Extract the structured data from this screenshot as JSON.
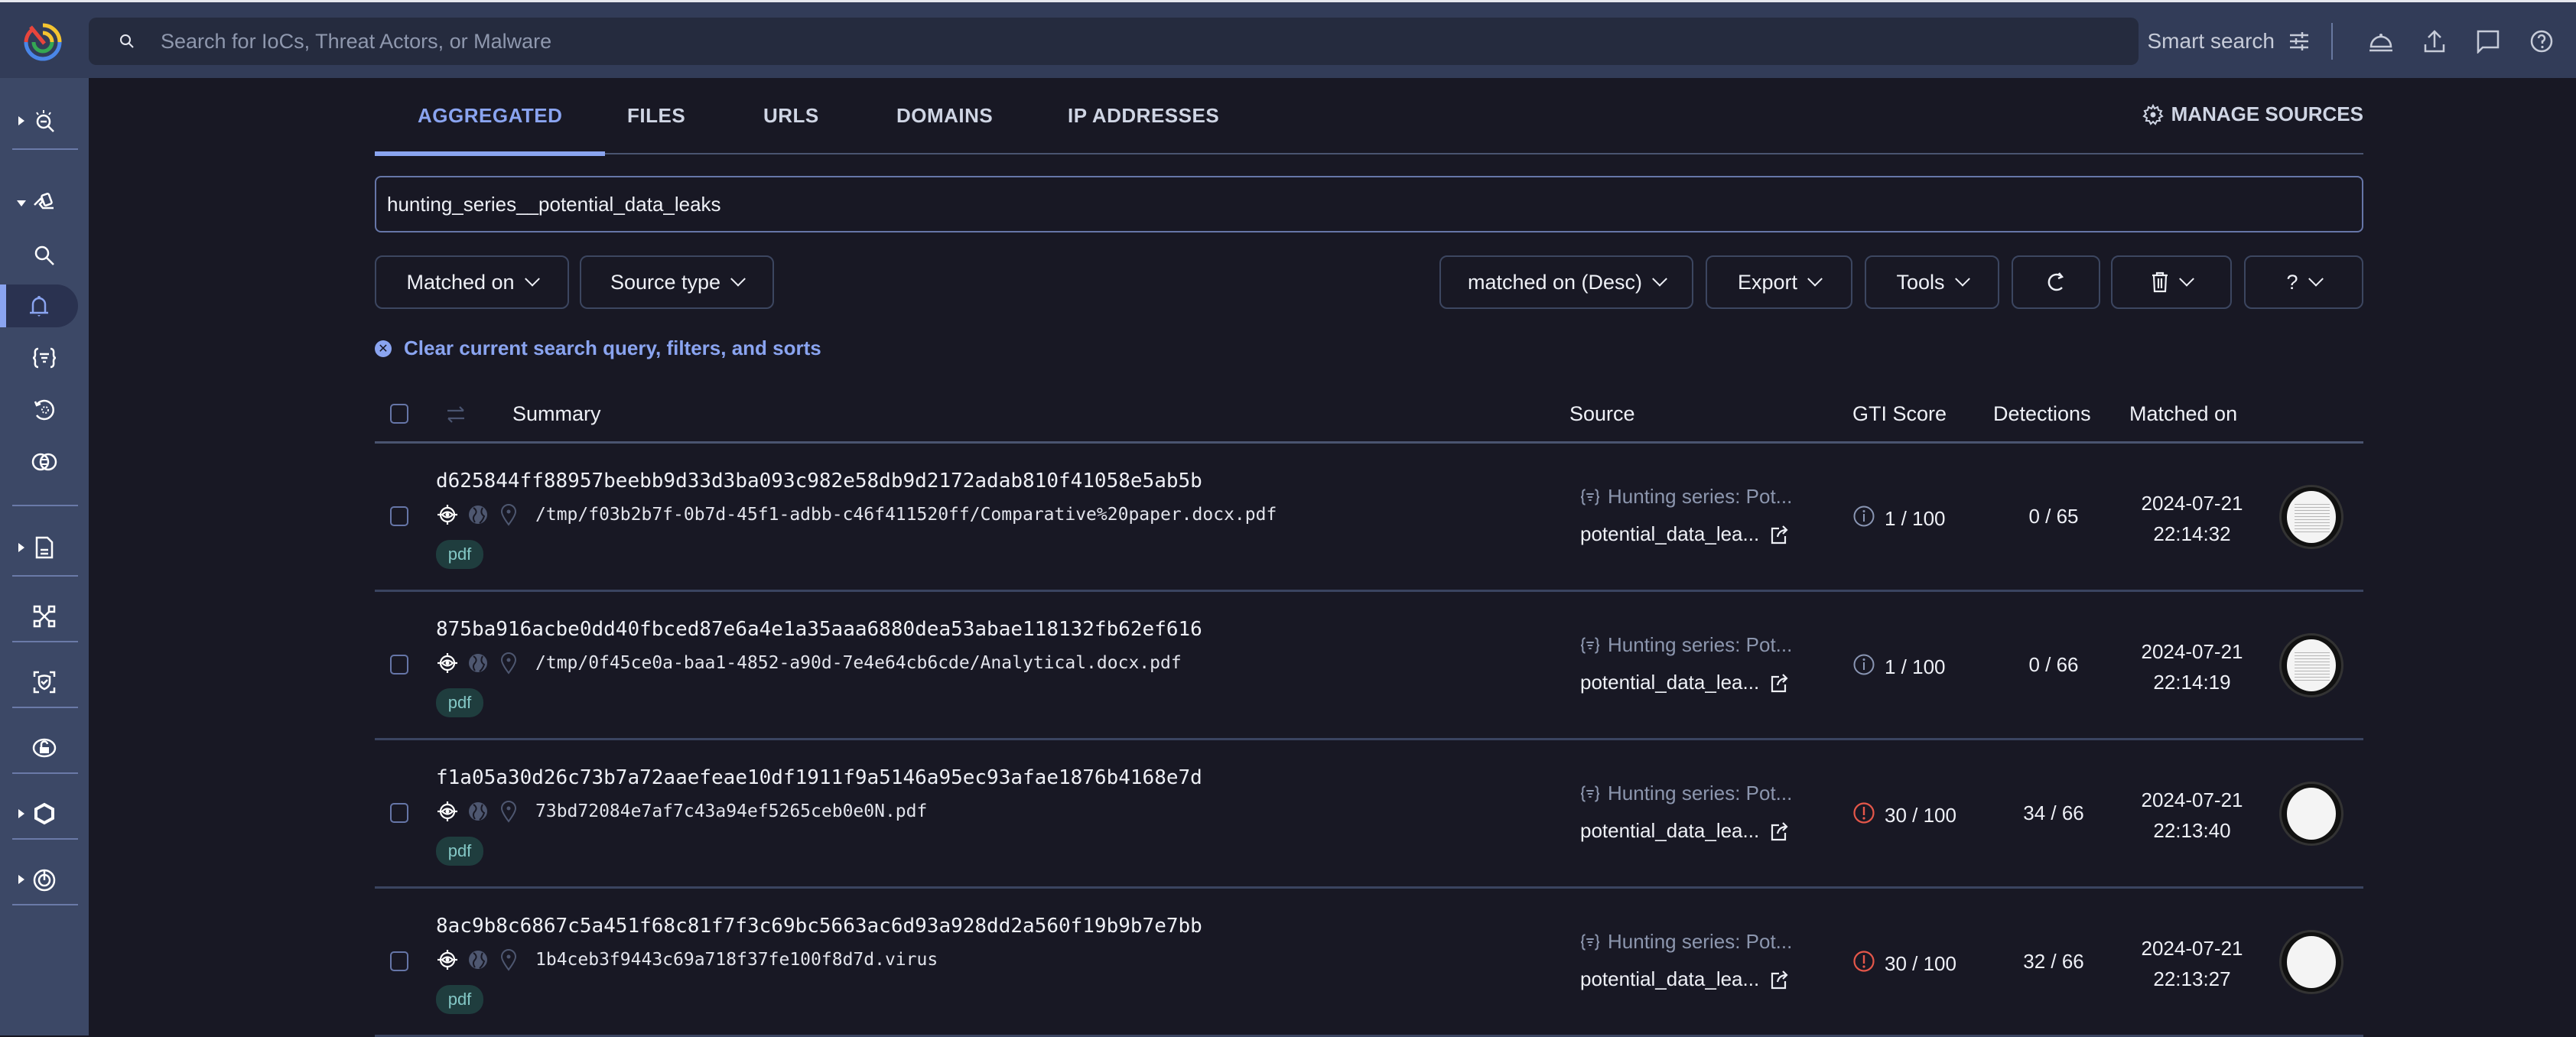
{
  "topbar": {
    "search_placeholder": "Search for IoCs, Threat Actors, or Malware",
    "smart_search_label": "Smart search",
    "icons": [
      "notifications-bell-icon",
      "upload-icon",
      "feedback-chat-icon",
      "help-icon"
    ]
  },
  "sidebar": {
    "items": [
      {
        "icon": "threat-landscape-icon",
        "expandable": true,
        "expanded": false
      },
      {
        "icon": "hunting-icon",
        "expandable": true,
        "expanded": true
      },
      {
        "icon": "search-icon"
      },
      {
        "icon": "bell-icon",
        "active": true
      },
      {
        "icon": "yara-rules-icon"
      },
      {
        "icon": "retrohunt-icon"
      },
      {
        "icon": "diff-icon"
      },
      {
        "icon": "reports-icon",
        "expandable": true,
        "expanded": false
      },
      {
        "icon": "graph-icon"
      },
      {
        "icon": "shield-check-icon"
      },
      {
        "icon": "unlock-icon"
      },
      {
        "icon": "hexagon-icon",
        "expandable": true,
        "expanded": false
      },
      {
        "icon": "asm-icon",
        "expandable": true,
        "expanded": false
      }
    ]
  },
  "tabs": [
    {
      "label": "AGGREGATED",
      "active": true
    },
    {
      "label": "FILES",
      "active": false
    },
    {
      "label": "URLS",
      "active": false
    },
    {
      "label": "DOMAINS",
      "active": false
    },
    {
      "label": "IP ADDRESSES",
      "active": false
    }
  ],
  "manage_sources_label": "MANAGE SOURCES",
  "query_value": "hunting_series__potential_data_leaks",
  "filters": {
    "matched_on": "Matched on",
    "source_type": "Source type",
    "sort": "matched on (Desc)",
    "export": "Export",
    "tools": "Tools",
    "help": "?"
  },
  "clear_label": "Clear current search query, filters, and sorts",
  "table": {
    "headers": {
      "summary": "Summary",
      "source": "Source",
      "gti_score": "GTI Score",
      "detections": "Detections",
      "matched_on": "Matched on"
    },
    "rows": [
      {
        "hash": "d625844ff88957beebb9d33d3ba093c982e58db9d2172adab810f41058e5ab5b",
        "path": "/tmp/f03b2b7f-0b7d-45f1-adbb-c46f411520ff/Comparative%20paper.docx.pdf",
        "tag": "pdf",
        "source_title": "Hunting series: Pot...",
        "source_name": "potential_data_lea...",
        "gti_score": "1 / 100",
        "gti_level": "info",
        "detections": "0 / 65",
        "date": "2024-07-21",
        "time": "22:14:32",
        "thumb": "text"
      },
      {
        "hash": "875ba916acbe0dd40fbced87e6a4e1a35aaa6880dea53abae118132fb62ef616",
        "path": "/tmp/0f45ce0a-baa1-4852-a90d-7e4e64cb6cde/Analytical.docx.pdf",
        "tag": "pdf",
        "source_title": "Hunting series: Pot...",
        "source_name": "potential_data_lea...",
        "gti_score": "1 / 100",
        "gti_level": "info",
        "detections": "0 / 66",
        "date": "2024-07-21",
        "time": "22:14:19",
        "thumb": "text"
      },
      {
        "hash": "f1a05a30d26c73b7a72aaefeae10df1911f9a5146a95ec93afae1876b4168e7d",
        "path": "73bd72084e7af7c43a94ef5265ceb0e0N.pdf",
        "tag": "pdf",
        "source_title": "Hunting series: Pot...",
        "source_name": "potential_data_lea...",
        "gti_score": "30 / 100",
        "gti_level": "warning",
        "detections": "34 / 66",
        "date": "2024-07-21",
        "time": "22:13:40",
        "thumb": "blank"
      },
      {
        "hash": "8ac9b8c6867c5a451f68c81f7f3c69bc5663ac6d93a928dd2a560f19b9b7e7bb",
        "path": "1b4ceb3f9443c69a718f37fe100f8d7d.virus",
        "tag": "pdf",
        "source_title": "Hunting series: Pot...",
        "source_name": "potential_data_lea...",
        "gti_score": "30 / 100",
        "gti_level": "warning",
        "detections": "32 / 66",
        "date": "2024-07-21",
        "time": "22:13:27",
        "thumb": "blank"
      }
    ]
  },
  "colors": {
    "accent": "#8aa4f0",
    "warning": "#e5574a",
    "info": "#8a96b4",
    "tag_bg": "#1f3d3e",
    "tag_text": "#84c8c6"
  }
}
